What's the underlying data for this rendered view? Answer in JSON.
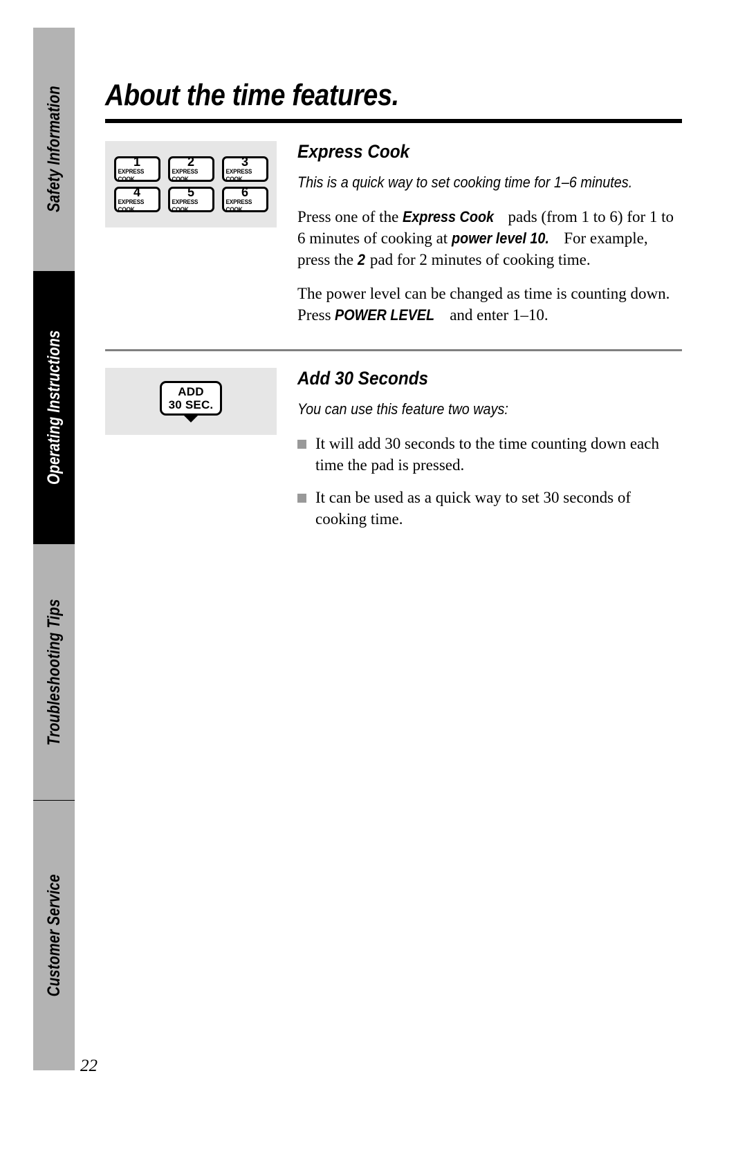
{
  "document": {
    "page_number": "22",
    "title": "About the time features."
  },
  "sidebar": {
    "tabs": [
      {
        "label": "Safety Information",
        "state": "inactive"
      },
      {
        "label": "Operating Instructions",
        "state": "active"
      },
      {
        "label": "Troubleshooting Tips",
        "state": "inactive"
      },
      {
        "label": "Customer Service",
        "state": "inactive"
      }
    ]
  },
  "colors": {
    "tab_inactive_bg": "#b3b3b3",
    "tab_active_bg": "#000000",
    "figure_panel_bg": "#e6e6e6",
    "bullet_marker": "#999999",
    "section_rule": "#808080"
  },
  "sections": [
    {
      "id": "express-cook",
      "heading": "Express Cook",
      "intro": "This is a quick way to set cooking time for 1–6 minutes.",
      "paragraphs": [
        {
          "runs": [
            {
              "text": "Press one of the ",
              "style": "normal"
            },
            {
              "text": "Express Cook",
              "style": "bold"
            },
            {
              "text": " pads (from 1 to 6) for 1 to 6 minutes of cooking at ",
              "style": "normal"
            },
            {
              "text": "power level 10.",
              "style": "bold"
            },
            {
              "text": " For example, press the ",
              "style": "normal"
            },
            {
              "text": "2",
              "style": "bold"
            },
            {
              "text": " pad for 2 minutes of cooking time.",
              "style": "normal"
            }
          ]
        },
        {
          "runs": [
            {
              "text": "The power level can be changed as time is counting down. Press ",
              "style": "normal"
            },
            {
              "text": "POWER LEVEL",
              "style": "bold"
            },
            {
              "text": " and enter 1–10.",
              "style": "normal"
            }
          ]
        }
      ],
      "figure": {
        "type": "keypad",
        "rows": [
          [
            {
              "number": "1",
              "caption": "EXPRESS COOK"
            },
            {
              "number": "2",
              "caption": "EXPRESS COOK"
            },
            {
              "number": "3",
              "caption": "EXPRESS COOK"
            }
          ],
          [
            {
              "number": "4",
              "caption": "EXPRESS COOK"
            },
            {
              "number": "5",
              "caption": "EXPRESS COOK"
            },
            {
              "number": "6",
              "caption": "EXPRESS COOK"
            }
          ]
        ]
      }
    },
    {
      "id": "add-30-seconds",
      "heading": "Add 30 Seconds",
      "intro": "You can use this feature two ways:",
      "bullets": [
        "It will add 30 seconds to the time counting down each time the pad is pressed.",
        "It can be used as a quick way to set 30 seconds of cooking time."
      ],
      "figure": {
        "type": "button",
        "line1": "ADD",
        "line2": "30 SEC."
      }
    }
  ]
}
